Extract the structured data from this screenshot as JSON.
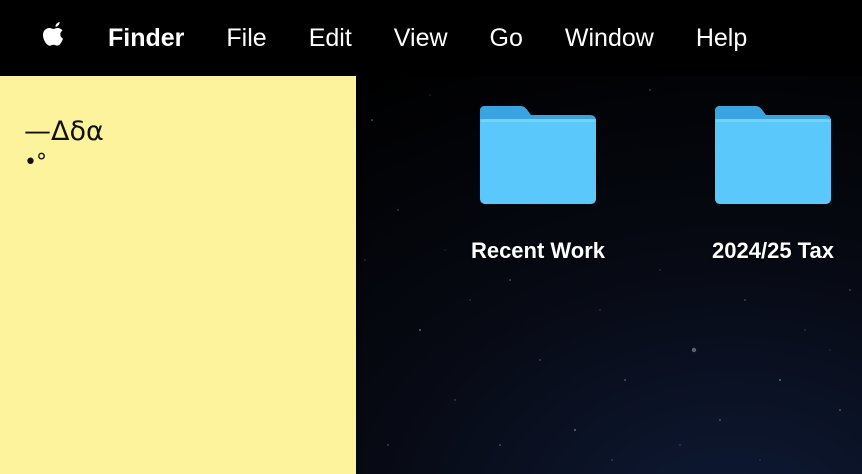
{
  "menubar": {
    "apple_icon": "apple-logo-icon",
    "app_name": "Finder",
    "items": [
      "File",
      "Edit",
      "View",
      "Go",
      "Window",
      "Help"
    ]
  },
  "sticky_note": {
    "color": "#fdf39c",
    "lines": [
      "—Δδα",
      "•°"
    ]
  },
  "desktop": {
    "folder_color": "#5ac8fa",
    "items": [
      {
        "label": "Recent Work",
        "icon": "folder-icon"
      },
      {
        "label": "2024/25 Tax",
        "icon": "folder-icon"
      }
    ]
  }
}
